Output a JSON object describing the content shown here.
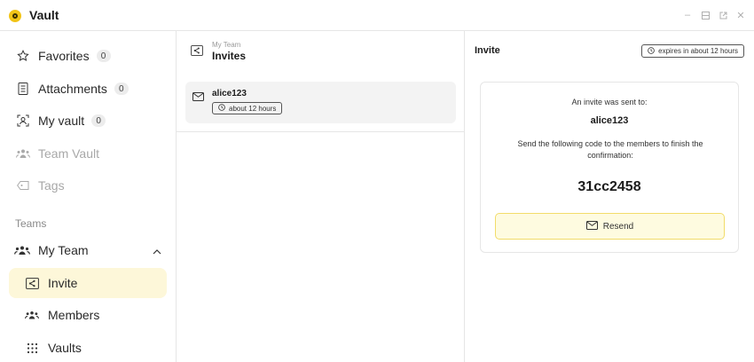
{
  "app": {
    "title": "Vault"
  },
  "sidebar": {
    "items": [
      {
        "label": "Favorites",
        "count": "0"
      },
      {
        "label": "Attachments",
        "count": "0"
      },
      {
        "label": "My vault",
        "count": "0"
      },
      {
        "label": "Team Vault"
      },
      {
        "label": "Tags"
      }
    ],
    "teams_label": "Teams",
    "team": {
      "name": "My Team",
      "sub_items": [
        {
          "label": "Invite"
        },
        {
          "label": "Members"
        },
        {
          "label": "Vaults"
        }
      ]
    }
  },
  "middle": {
    "breadcrumb": "My Team",
    "title": "Invites",
    "invites": [
      {
        "user": "alice123",
        "expires": "about 12 hours"
      }
    ]
  },
  "detail": {
    "title": "Invite",
    "expires": "expires in about 12 hours",
    "sent_to_label": "An invite was sent to:",
    "user": "alice123",
    "instructions": "Send the following code to the members to finish the confirmation:",
    "code": "31cc2458",
    "resend_label": "Resend"
  },
  "colors": {
    "accent": "#f2c417",
    "active_bg": "#fdf7d9",
    "resend_bg": "#fefbe0",
    "resend_border": "#f2dc6a"
  }
}
